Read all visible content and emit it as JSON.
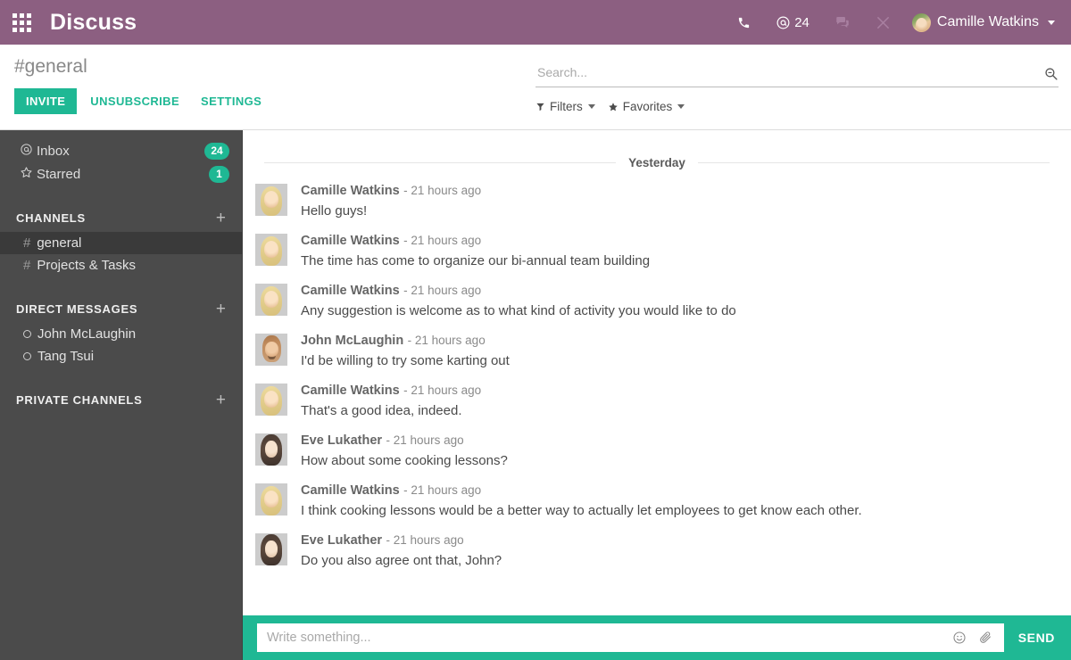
{
  "navbar": {
    "apps_icon": "apps-grid-icon",
    "brand": "Discuss",
    "icons": [
      {
        "name": "phone-icon",
        "glyph": "☎"
      },
      {
        "name": "mention-icon",
        "glyph": "@",
        "count": "24"
      },
      {
        "name": "messages-icon",
        "glyph": "💬"
      },
      {
        "name": "tools-icon",
        "glyph": "⚒"
      }
    ],
    "mention_label": "@",
    "mention_count": "24",
    "user_name": "Camille Watkins"
  },
  "control_panel": {
    "channel_title": "#general",
    "invite_label": "INVITE",
    "unsubscribe_label": "UNSUBSCRIBE",
    "settings_label": "SETTINGS",
    "search_placeholder": "Search...",
    "search_value": "",
    "filters_label": "Filters",
    "favorites_label": "Favorites"
  },
  "sidebar": {
    "inbox": {
      "label": "Inbox",
      "icon": "at-icon",
      "badge": "24"
    },
    "starred": {
      "label": "Starred",
      "icon": "star-icon",
      "badge": "1"
    },
    "sections": [
      {
        "title": "CHANNELS",
        "add_icon": "plus-icon",
        "items": [
          {
            "label": "general",
            "prefix": "#",
            "active": true
          },
          {
            "label": "Projects & Tasks",
            "prefix": "#",
            "active": false
          }
        ]
      },
      {
        "title": "DIRECT MESSAGES",
        "add_icon": "plus-icon",
        "items": [
          {
            "label": "John McLaughin",
            "prefix": "o",
            "active": false
          },
          {
            "label": "Tang Tsui",
            "prefix": "o",
            "active": false
          }
        ]
      },
      {
        "title": "PRIVATE CHANNELS",
        "add_icon": "plus-icon",
        "items": []
      }
    ]
  },
  "thread": {
    "date_separator": "Yesterday",
    "messages": [
      {
        "author": "Camille Watkins",
        "time": "- 21 hours ago",
        "text": "Hello guys!",
        "avatar": "av-camille"
      },
      {
        "author": "Camille Watkins",
        "time": "- 21 hours ago",
        "text": "The time has come to organize our bi-annual team building",
        "avatar": "av-camille"
      },
      {
        "author": "Camille Watkins",
        "time": "- 21 hours ago",
        "text": "Any suggestion is welcome as to what kind of activity you would like to do",
        "avatar": "av-camille"
      },
      {
        "author": "John McLaughin",
        "time": "- 21 hours ago",
        "text": "I'd be willing to try some karting out",
        "avatar": "av-john"
      },
      {
        "author": "Camille Watkins",
        "time": "- 21 hours ago",
        "text": "That's a good idea, indeed.",
        "avatar": "av-camille"
      },
      {
        "author": "Eve Lukather",
        "time": "- 21 hours ago",
        "text": "How about some cooking lessons?",
        "avatar": "av-eve"
      },
      {
        "author": "Camille Watkins",
        "time": "- 21 hours ago",
        "text": "I think cooking lessons would be a better way to actually let employees to get know each other.",
        "avatar": "av-camille"
      },
      {
        "author": "Eve Lukather",
        "time": "- 21 hours ago",
        "text": "Do you also agree ont that, John?",
        "avatar": "av-eve"
      }
    ]
  },
  "composer": {
    "placeholder": "Write something...",
    "value": "",
    "emoji_icon": "smiley-icon",
    "attach_icon": "paperclip-icon",
    "send_label": "SEND"
  },
  "colors": {
    "navbar": "#8c5f81",
    "accent": "#1fb894",
    "sidebar": "#4b4b4b",
    "sidebar_active": "#3a3a3a"
  }
}
